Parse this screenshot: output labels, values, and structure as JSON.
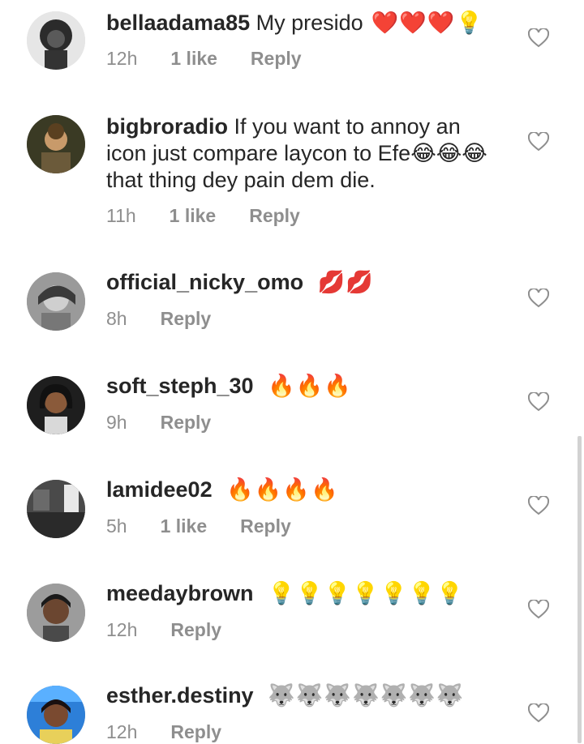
{
  "comments": [
    {
      "username": "bellaadama85",
      "text": "My presido",
      "emojis": "❤️❤️❤️💡",
      "time": "12h",
      "likes": "1 like",
      "reply": "Reply"
    },
    {
      "username": "bigbroradio",
      "text": "If you want to annoy an icon just compare laycon to Efe😂😂😂 that thing dey pain dem die.",
      "emojis": "",
      "time": "11h",
      "likes": "1 like",
      "reply": "Reply"
    },
    {
      "username": "official_nicky_omo",
      "text": "",
      "emojis": "💋💋",
      "time": "8h",
      "likes": "",
      "reply": "Reply"
    },
    {
      "username": "soft_steph_30",
      "text": "",
      "emojis": "🔥🔥🔥",
      "time": "9h",
      "likes": "",
      "reply": "Reply"
    },
    {
      "username": "lamidee02",
      "text": "",
      "emojis": "🔥🔥🔥🔥",
      "time": "5h",
      "likes": "1 like",
      "reply": "Reply"
    },
    {
      "username": "meedaybrown",
      "text": "",
      "emojis": "💡💡💡💡💡💡💡",
      "time": "12h",
      "likes": "",
      "reply": "Reply"
    },
    {
      "username": "esther.destiny",
      "text": "",
      "emojis": "🐺🐺🐺🐺🐺🐺🐺",
      "time": "12h",
      "likes": "",
      "reply": "Reply"
    }
  ],
  "icons": {
    "like": "heart-outline-icon"
  },
  "colors": {
    "username": "#262626",
    "meta": "#8e8e8e",
    "heart_outline": "#8e8e8e"
  }
}
